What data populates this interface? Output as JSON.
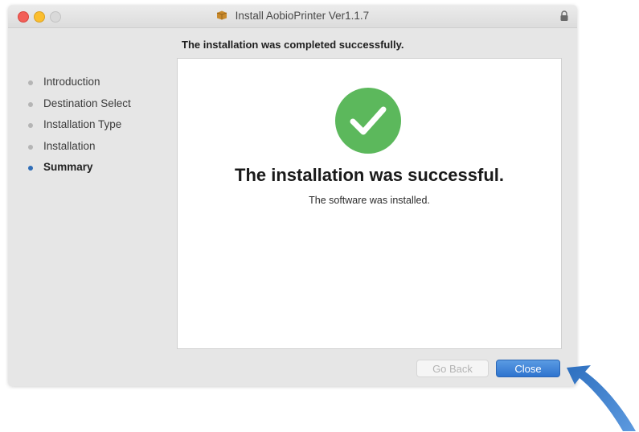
{
  "window": {
    "title": "Install AobioPrinter Ver1.1.7"
  },
  "header": {
    "status_text": "The installation was completed successfully."
  },
  "sidebar": {
    "steps": [
      {
        "label": "Introduction",
        "active": false
      },
      {
        "label": "Destination Select",
        "active": false
      },
      {
        "label": "Installation Type",
        "active": false
      },
      {
        "label": "Installation",
        "active": false
      },
      {
        "label": "Summary",
        "active": true
      }
    ]
  },
  "main": {
    "title": "The installation was successful.",
    "subtitle": "The software was installed."
  },
  "buttons": {
    "go_back_label": "Go Back",
    "close_label": "Close"
  },
  "icons": {
    "success": "checkmark-circle-icon",
    "package": "package-icon",
    "lock": "lock-icon",
    "pointer": "pointer-arrow-icon"
  },
  "colors": {
    "success_green": "#5cb85c",
    "accent_blue": "#2f74cf",
    "active_step_dot": "#2f6db7"
  }
}
